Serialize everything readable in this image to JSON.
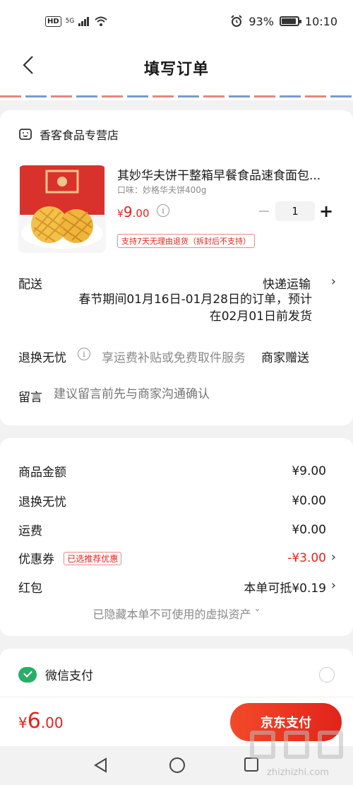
{
  "status_bar": {
    "hd": "HD",
    "net": "5G",
    "battery": "93%",
    "battery_level": 0.93,
    "time": "10:10"
  },
  "header": {
    "title": "填写订单",
    "back_icon": "chevron-left-icon"
  },
  "store": {
    "name": "香客食品专营店",
    "icon": "store-icon"
  },
  "product": {
    "title": "其妙华夫饼干整箱早餐食品速食面包...",
    "spec": "口味：妙格华夫饼400g",
    "price_currency": "¥",
    "price_int": "9",
    "price_dec": ".00",
    "quantity": "1",
    "minus": "−",
    "plus": "+",
    "return_policy": "支持7天无理由退货（拆封后不支持）"
  },
  "delivery": {
    "label": "配送",
    "method": "快递运输",
    "note_line1": "春节期间01月16日-01月28日的订单，预计",
    "note_line2": "在02月01日前发货"
  },
  "return_worry": {
    "label": "退换无忧",
    "description": "享运费补贴或免费取件服务",
    "value": "商家赠送"
  },
  "remark": {
    "label": "留言",
    "placeholder": "建议留言前先与商家沟通确认"
  },
  "summary": {
    "goods_label": "商品金额",
    "goods_value": "¥9.00",
    "return_label": "退换无忧",
    "return_value": "¥0.00",
    "shipping_label": "运费",
    "shipping_value": "¥0.00",
    "coupon_label": "优惠券",
    "coupon_tag": "已选推荐优惠",
    "coupon_value": "-¥3.00",
    "redpacket_label": "红包",
    "redpacket_value": "本单可抵¥0.19",
    "hidden_assets": "已隐藏本单不可使用的虚拟资产 ˇ"
  },
  "payment": {
    "wechat_label": "微信支付",
    "wechat_icon": "wechat-pay-icon"
  },
  "bottom": {
    "total_currency": "¥",
    "total_int": "6",
    "total_dec": ".00",
    "pay_button": "京东支付"
  },
  "watermark": {
    "text": "zhizhizhi.com"
  },
  "colors": {
    "accent": "#e2231a",
    "wechat": "#2aae67"
  }
}
